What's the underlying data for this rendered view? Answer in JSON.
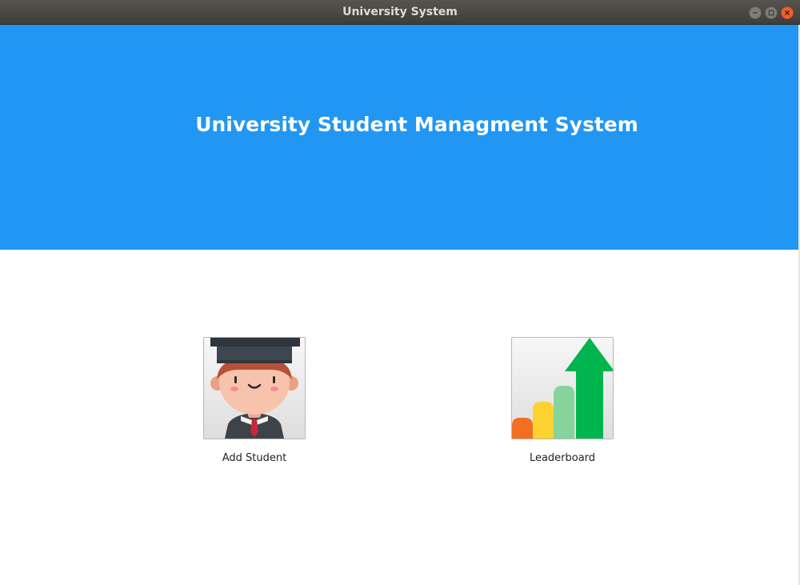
{
  "window": {
    "title": "University System"
  },
  "header": {
    "title": "University Student Managment System",
    "background_color": "#2196f3"
  },
  "actions": [
    {
      "label": "Add Student",
      "icon": "student-graduate-icon"
    },
    {
      "label": "Leaderboard",
      "icon": "leaderboard-chart-icon"
    }
  ],
  "colors": {
    "close_button": "#e9612d",
    "header_text": "#ffffff"
  }
}
